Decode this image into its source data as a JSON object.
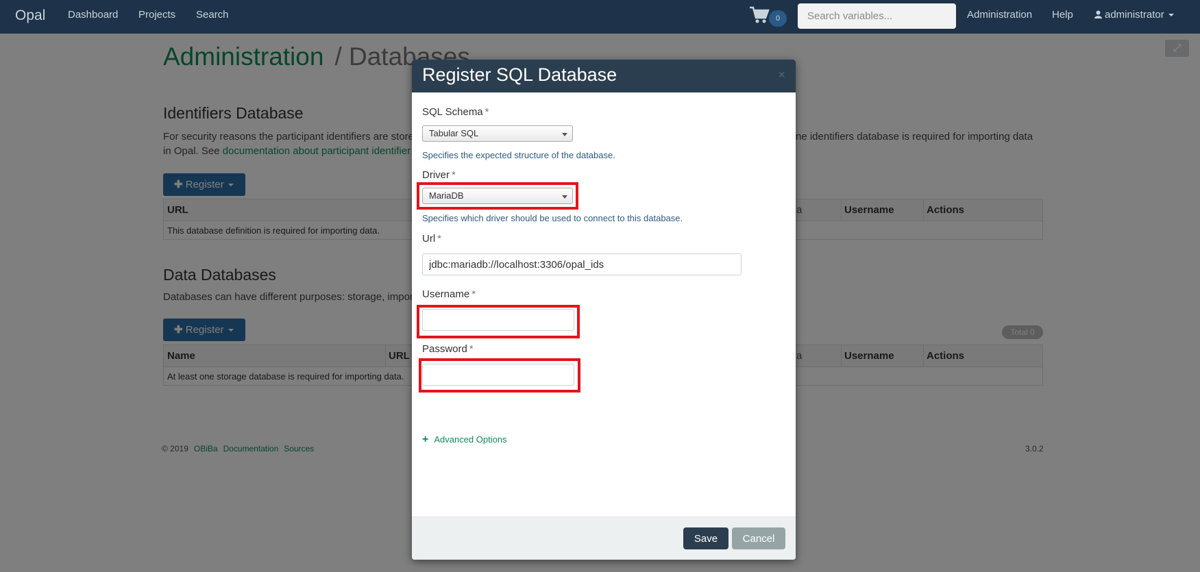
{
  "navbar": {
    "brand": "Opal",
    "links": [
      "Dashboard",
      "Projects",
      "Search"
    ],
    "cart_count": "0",
    "search_placeholder": "Search variables...",
    "right_links": [
      "Administration",
      "Help"
    ],
    "user": "administrator"
  },
  "page": {
    "title": "Administration",
    "subtitle": "/ Databases",
    "identifiers": {
      "title": "Identifiers Database",
      "desc_line1_start": "For security reasons the participant identifiers are store",
      "desc_line1_end": "ne identifiers database is required for importing data",
      "desc_line2_start": "in Opal. See ",
      "desc_link": "documentation about participant identifier",
      "register_label": "Register",
      "columns": [
        "URL",
        "a",
        "Username",
        "Actions"
      ],
      "empty_text": "This database definition is required for importing data."
    },
    "data_databases": {
      "title": "Data Databases",
      "desc": "Databases can have different purposes: storage, impor",
      "register_label": "Register",
      "total_label": "Total 0",
      "columns": [
        "Name",
        "URL",
        "a",
        "Username",
        "Actions"
      ],
      "empty_text": "At least one storage database is required for importing data."
    },
    "footer": {
      "copyright": "© 2019",
      "links": [
        "OBiBa",
        "Documentation",
        "Sources"
      ],
      "version": "3.0.2"
    }
  },
  "modal": {
    "title": "Register SQL Database",
    "close": "×",
    "sql_schema": {
      "label": "SQL Schema",
      "required": "*",
      "value": "Tabular SQL",
      "hint": "Specifies the expected structure of the database."
    },
    "driver": {
      "label": "Driver",
      "required": "*",
      "value": "MariaDB",
      "hint": "Specifies which driver should be used to connect to this database."
    },
    "url": {
      "label": "Url",
      "required": "*",
      "value": "jdbc:mariadb://localhost:3306/opal_ids"
    },
    "username": {
      "label": "Username",
      "required": "*",
      "value": ""
    },
    "password": {
      "label": "Password",
      "required": "*",
      "value": ""
    },
    "advanced_options": "Advanced Options",
    "save_label": "Save",
    "cancel_label": "Cancel"
  },
  "colors": {
    "navbar": "#1e3349",
    "modal_header": "#2b3e50",
    "accent_green": "#0e8a5a",
    "highlight_red": "#e3151c",
    "cancel_gray": "#95a5a6"
  }
}
